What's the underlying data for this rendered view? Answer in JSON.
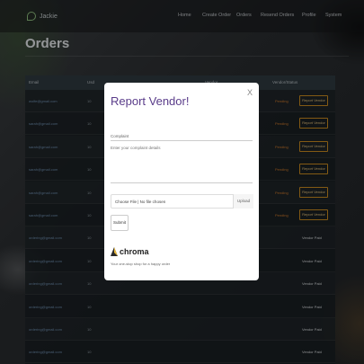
{
  "brand": {
    "name": "Jackie"
  },
  "nav": [
    "Home",
    "Create Order",
    "Orders",
    "Resend Orders",
    "Profile",
    "System"
  ],
  "page_title": "Orders",
  "table": {
    "headers": [
      "Email",
      "Usd",
      "Vendor",
      "Vendor/Status"
    ],
    "rows": [
      {
        "email": "wolfe@gmail.com",
        "num": "10",
        "status": "Pending",
        "action": "Report Vendor"
      },
      {
        "email": "sarah@gmail.com",
        "num": "10",
        "status": "Pending",
        "action": "Report Vendor"
      },
      {
        "email": "sarah@gmail.com",
        "num": "10",
        "status": "Pending",
        "action": "Report Vendor"
      },
      {
        "email": "sarah@gmail.com",
        "num": "10",
        "status": "Pending",
        "action": "Report Vendor"
      },
      {
        "email": "sarah@gmail.com",
        "num": "10",
        "status": "Pending",
        "action": "Report Vendor"
      },
      {
        "email": "sarah@gmail.com",
        "num": "10",
        "status": "Pending",
        "action": "Report Vendor"
      },
      {
        "email": "ordering@gmail.com",
        "num": "10",
        "status": "",
        "action": "Vendor Paid"
      },
      {
        "email": "ordering@gmail.com",
        "num": "10",
        "status": "",
        "action": "Vendor Paid"
      },
      {
        "email": "ordering@gmail.com",
        "num": "10",
        "status": "",
        "action": "Vendor Paid"
      },
      {
        "email": "ordering@gmail.com",
        "num": "10",
        "status": "",
        "action": "Vendor Paid"
      },
      {
        "email": "ordering@gmail.com",
        "num": "10",
        "status": "",
        "action": "Vendor Paid"
      },
      {
        "email": "ordering@gmail.com",
        "num": "10",
        "status": "",
        "action": "Vendor Paid"
      }
    ]
  },
  "modal": {
    "title": "Report Vendor!",
    "close": "X",
    "complaint_label": "Complaint",
    "complaint_placeholder": "Enter your complaint details",
    "file_choose": "Choose File | No file chosen",
    "upload_label": "Upload",
    "submit_label": "Submit",
    "footer_brand": "chroma",
    "footer_sub": "Your one-stop shop for a happy order"
  },
  "colors": {
    "accent": "#5a3c8a",
    "action_border": "#c98a20",
    "status_pending": "#d07a2a"
  }
}
